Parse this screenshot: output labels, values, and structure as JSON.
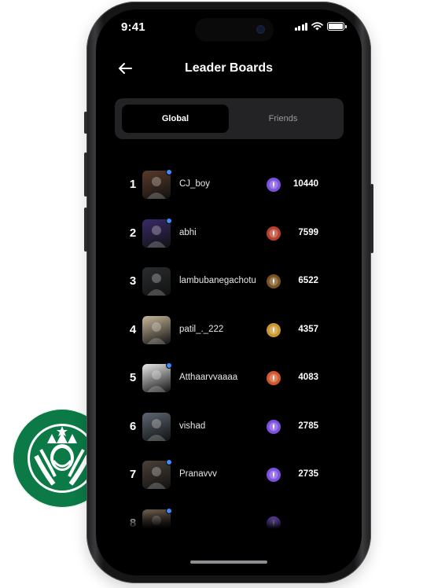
{
  "status_bar": {
    "time": "9:41"
  },
  "header": {
    "title": "Leader Boards"
  },
  "tabs": [
    {
      "label": "Global",
      "active": true
    },
    {
      "label": "Friends",
      "active": false
    }
  ],
  "leaderboard": [
    {
      "rank": "1",
      "username": "CJ_boy",
      "score": "10440",
      "verified": true,
      "badge_icon": "purple-tier-badge-icon",
      "badge_color": "#7b4fe0",
      "avatar_color": "#5a3a2a"
    },
    {
      "rank": "2",
      "username": "abhi",
      "score": "7599",
      "verified": true,
      "badge_icon": "red-tier-badge-icon",
      "badge_color": "#b8402c",
      "avatar_color": "#3a2a6a"
    },
    {
      "rank": "3",
      "username": "lambubanegachotu",
      "score": "6522",
      "verified": false,
      "badge_icon": "bronze-tier-badge-icon",
      "badge_color": "#7a5320",
      "avatar_color": "#2a2d30"
    },
    {
      "rank": "4",
      "username": "patil_._222",
      "score": "4357",
      "verified": false,
      "badge_icon": "gold-tier-badge-icon",
      "badge_color": "#c9962e",
      "avatar_color": "#c8b89a"
    },
    {
      "rank": "5",
      "username": "Atthaarvvaaaa",
      "score": "4083",
      "verified": true,
      "badge_icon": "orange-tier-badge-icon",
      "badge_color": "#d2572a",
      "avatar_color": "#e9e9e9"
    },
    {
      "rank": "6",
      "username": "vishad",
      "score": "2785",
      "verified": false,
      "badge_icon": "purple-tier-badge-icon",
      "badge_color": "#7b4fe0",
      "avatar_color": "#5d6772"
    },
    {
      "rank": "7",
      "username": "Pranavvv",
      "score": "2735",
      "verified": true,
      "badge_icon": "purple-tier-badge-icon",
      "badge_color": "#7b4fe0",
      "avatar_color": "#4a4038"
    },
    {
      "rank": "8",
      "username": "",
      "score": "",
      "verified": true,
      "badge_icon": "purple-tier-badge-icon",
      "badge_color": "#7b4fe0",
      "avatar_color": "#6a5a4a"
    }
  ]
}
